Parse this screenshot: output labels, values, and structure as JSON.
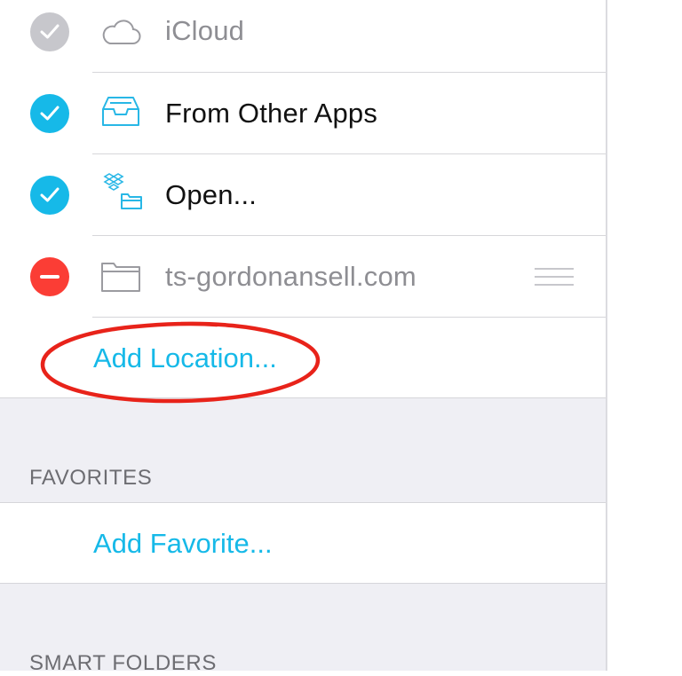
{
  "locations": {
    "items": [
      {
        "label": "iCloud",
        "state": "enabled-disabled-check",
        "icon": "cloud-icon"
      },
      {
        "label": "From Other Apps",
        "state": "checked",
        "icon": "tray-icon"
      },
      {
        "label": "Open...",
        "state": "checked",
        "icon": "dropbox-folder-icon"
      },
      {
        "label": "ts-gordonansell.com",
        "state": "delete",
        "icon": "folder-icon"
      }
    ],
    "add_location_label": "Add Location..."
  },
  "favorites": {
    "header": "FAVORITES",
    "add_favorite_label": "Add Favorite..."
  },
  "smart_folders": {
    "header": "SMART FOLDERS"
  },
  "colors": {
    "accent": "#16b9e8",
    "check_gray": "#c7c7cc",
    "delete_red": "#fb3d35",
    "annotation_red": "#e8231a",
    "icon_blue": "#28b7e6",
    "icon_gray": "#9b9ba0",
    "text_dark": "#111111",
    "text_gray": "#8e8e93"
  }
}
